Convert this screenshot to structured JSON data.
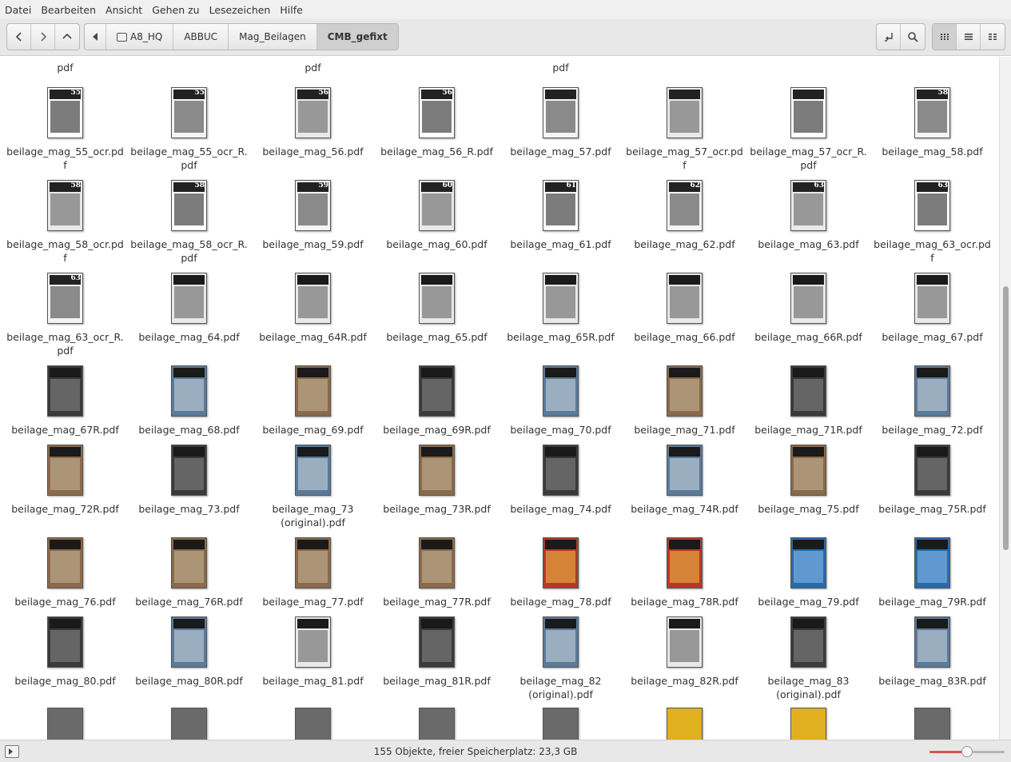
{
  "menu": [
    "Datei",
    "Bearbeiten",
    "Ansicht",
    "Gehen zu",
    "Lesezeichen",
    "Hilfe"
  ],
  "breadcrumbs": [
    "A8_HQ",
    "ABBUC",
    "Mag_Beilagen",
    "CMB_gefixt"
  ],
  "partial_top_row": [
    "pdf",
    "pdf",
    "pdf"
  ],
  "files": [
    "beilage_mag_55_ocr.pdf",
    "beilage_mag_55_ocr_R.pdf",
    "beilage_mag_56.pdf",
    "beilage_mag_56_R.pdf",
    "beilage_mag_57.pdf",
    "beilage_mag_57_ocr.pdf",
    "beilage_mag_57_ocr_R.pdf",
    "beilage_mag_58.pdf",
    "beilage_mag_58_ocr.pdf",
    "beilage_mag_58_ocr_R.pdf",
    "beilage_mag_59.pdf",
    "beilage_mag_60.pdf",
    "beilage_mag_61.pdf",
    "beilage_mag_62.pdf",
    "beilage_mag_63.pdf",
    "beilage_mag_63_ocr.pdf",
    "beilage_mag_63_ocr_R.pdf",
    "beilage_mag_64.pdf",
    "beilage_mag_64R.pdf",
    "beilage_mag_65.pdf",
    "beilage_mag_65R.pdf",
    "beilage_mag_66.pdf",
    "beilage_mag_66R.pdf",
    "beilage_mag_67.pdf",
    "beilage_mag_67R.pdf",
    "beilage_mag_68.pdf",
    "beilage_mag_69.pdf",
    "beilage_mag_69R.pdf",
    "beilage_mag_70.pdf",
    "beilage_mag_71.pdf",
    "beilage_mag_71R.pdf",
    "beilage_mag_72.pdf",
    "beilage_mag_72R.pdf",
    "beilage_mag_73.pdf",
    "beilage_mag_73 (original).pdf",
    "beilage_mag_73R.pdf",
    "beilage_mag_74.pdf",
    "beilage_mag_74R.pdf",
    "beilage_mag_75.pdf",
    "beilage_mag_75R.pdf",
    "beilage_mag_76.pdf",
    "beilage_mag_76R.pdf",
    "beilage_mag_77.pdf",
    "beilage_mag_77R.pdf",
    "beilage_mag_78.pdf",
    "beilage_mag_78R.pdf",
    "beilage_mag_79.pdf",
    "beilage_mag_79R.pdf",
    "beilage_mag_80.pdf",
    "beilage_mag_80R.pdf",
    "beilage_mag_81.pdf",
    "beilage_mag_81R.pdf",
    "beilage_mag_82 (original).pdf",
    "beilage_mag_82R.pdf",
    "beilage_mag_83 (original).pdf",
    "beilage_mag_83R.pdf"
  ],
  "thumb_numbers": [
    "55",
    "55",
    "56",
    "56",
    "",
    "",
    "",
    "58",
    "58",
    "58",
    "59",
    "60",
    "61",
    "62",
    "63",
    "63",
    "63"
  ],
  "status": "155 Objekte, freier Speicherplatz: 23,3 GB",
  "zoom_level": 0.5,
  "colors": {
    "accent": "#d9534f",
    "active_crumb": "#cfcfcf"
  }
}
